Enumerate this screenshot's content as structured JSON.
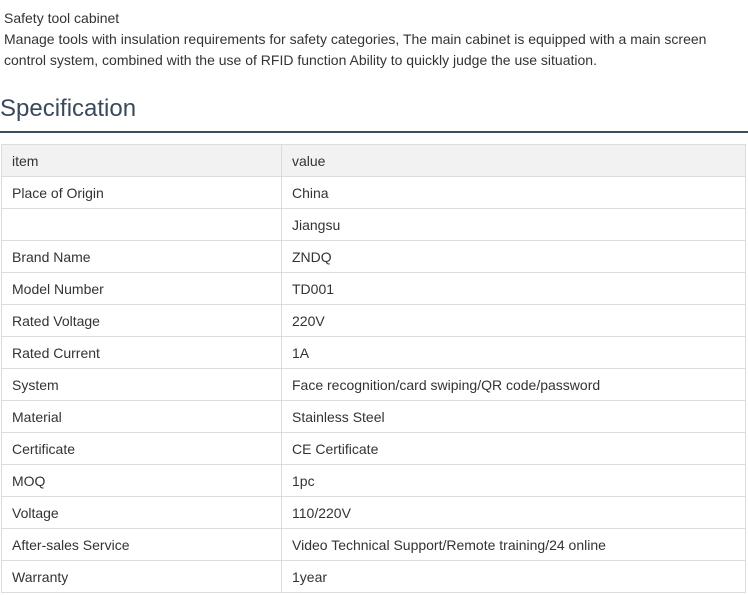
{
  "intro": {
    "title": "Safety tool cabinet",
    "description": "Manage tools with insulation requirements for safety categories, The main cabinet is equipped with a main screen control system, combined with the use of RFID function Ability to quickly judge the use situation."
  },
  "specification": {
    "heading": "Specification",
    "columns": [
      "item",
      "value"
    ],
    "rows": [
      [
        "Place of Origin",
        "China"
      ],
      [
        "",
        "Jiangsu"
      ],
      [
        "Brand Name",
        "ZNDQ"
      ],
      [
        "Model Number",
        "TD001"
      ],
      [
        "Rated Voltage",
        "220V"
      ],
      [
        "Rated Current",
        "1A"
      ],
      [
        "System",
        "Face recognition/card swiping/QR code/password"
      ],
      [
        "Material",
        "Stainless Steel"
      ],
      [
        "Certificate",
        "CE Certificate"
      ],
      [
        "MOQ",
        "1pc"
      ],
      [
        "Voltage",
        "110/220V"
      ],
      [
        "After-sales Service",
        "Video Technical Support/Remote training/24 online"
      ],
      [
        "Warranty",
        "1year"
      ]
    ]
  },
  "colors": {
    "text": "#333333",
    "heading": "#3a4a5c",
    "rule": "#3d4d60",
    "table_border": "#dcdcdc",
    "header_bg": "#f2f2f2"
  }
}
